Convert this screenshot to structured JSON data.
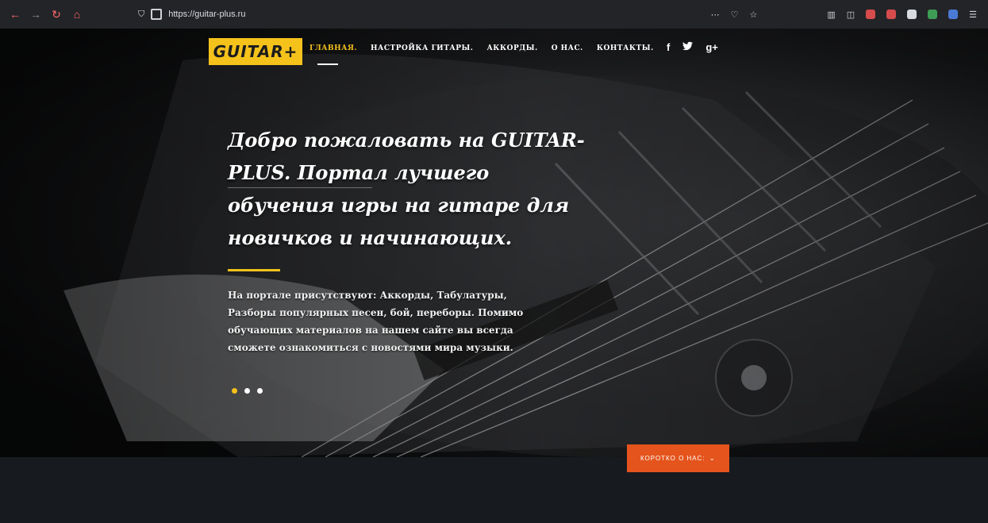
{
  "browser": {
    "url": "https://guitar-plus.ru"
  },
  "site": {
    "logo_text": "GUITAR+",
    "nav": [
      {
        "label": "ГЛАВНАЯ."
      },
      {
        "label": "НАСТРОЙКА ГИТАРЫ."
      },
      {
        "label": "АККОРДЫ."
      },
      {
        "label": "О НАС."
      },
      {
        "label": "КОНТАКТЫ."
      }
    ],
    "social": {
      "facebook": "f",
      "twitter": "🐦",
      "google_plus": "g+"
    }
  },
  "hero": {
    "headline": "Добро пожаловать на GUITAR-PLUS. Портал лучшего обучения игры на гитаре для новичков и начинающих.",
    "description": "На портале присутствуют: Аккорды, Табулатуры, Разборы популярных песен, бой, переборы. Помимо обучающих материалов на нашем сайте вы всегда сможете ознакомиться с новостями мира музыки.",
    "slider_active_index": 1,
    "slider_total": 3
  },
  "cta": {
    "about_label": "КОРОТКО О НАС:",
    "chevron": "⌄"
  },
  "colors": {
    "accent_yellow": "#f5c21b",
    "cta_orange": "#e4541c",
    "band_dark": "#171a1f"
  }
}
